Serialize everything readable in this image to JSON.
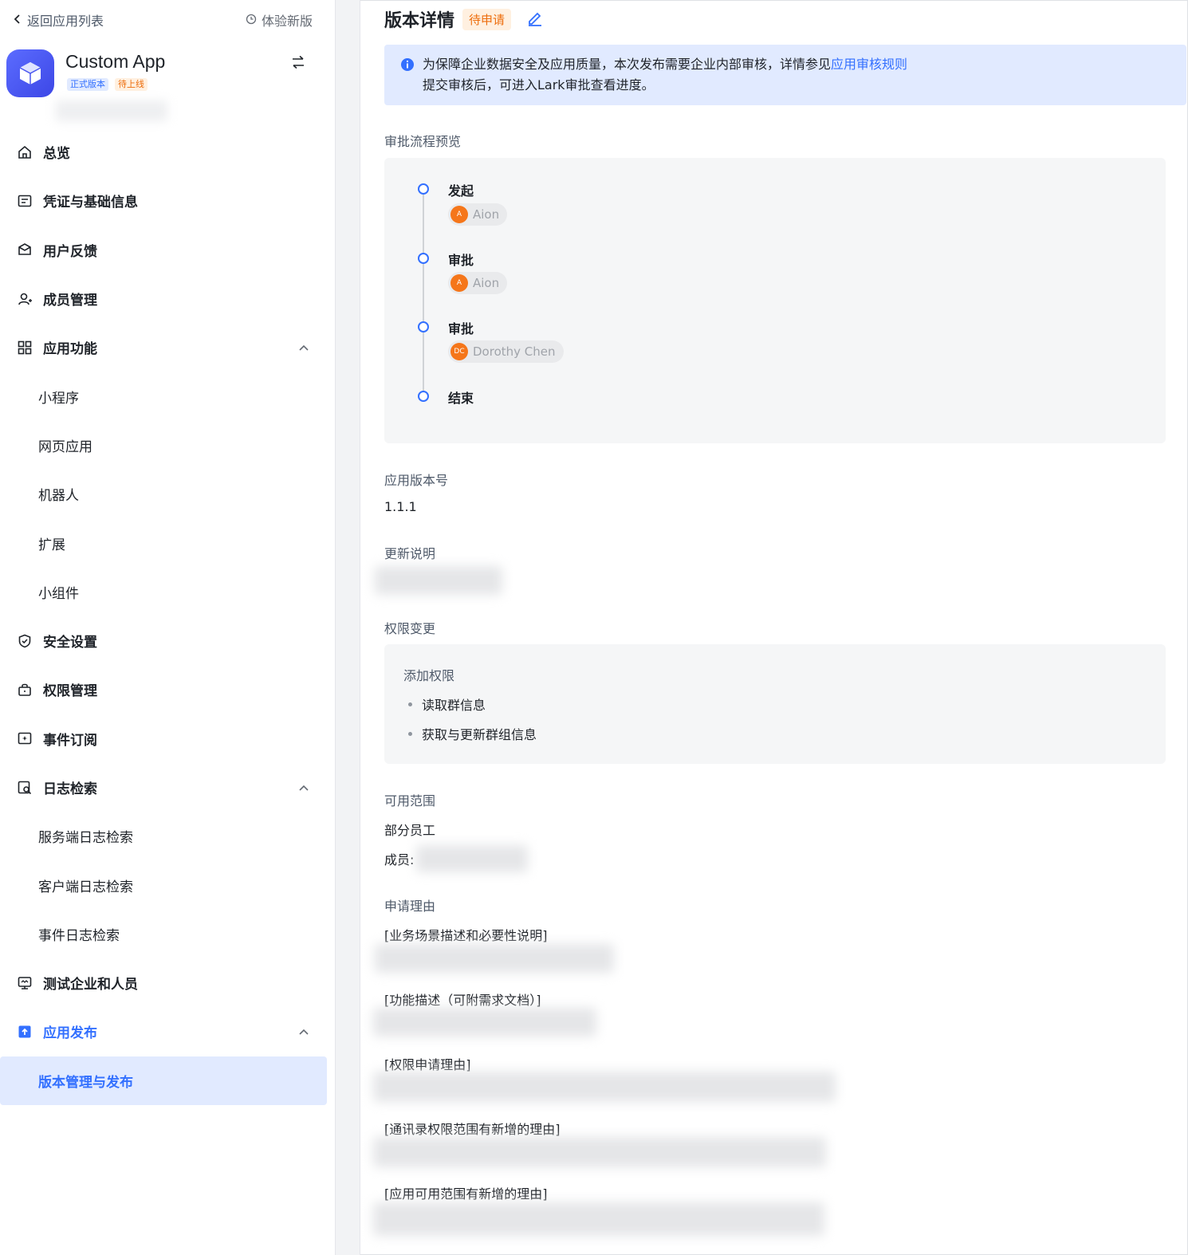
{
  "sidebar": {
    "back_label": "返回应用列表",
    "new_version_label": "体验新版",
    "app_name": "Custom App",
    "tag_release": "正式版本",
    "tag_pending": "待上线",
    "nav": {
      "overview": "总览",
      "credentials": "凭证与基础信息",
      "feedback": "用户反馈",
      "members": "成员管理",
      "features": "应用功能",
      "mini_program": "小程序",
      "web_app": "网页应用",
      "bot": "机器人",
      "extension": "扩展",
      "widget": "小组件",
      "security": "安全设置",
      "permissions": "权限管理",
      "events": "事件订阅",
      "logs": "日志检索",
      "server_logs": "服务端日志检索",
      "client_logs": "客户端日志检索",
      "event_logs": "事件日志检索",
      "test_tenant": "测试企业和人员",
      "publish": "应用发布",
      "version_mgmt": "版本管理与发布"
    }
  },
  "main": {
    "title": "版本详情",
    "status": "待申请",
    "notice_line1": "为保障企业数据安全及应用质量，本次发布需要企业内部审核，详情参见",
    "notice_link": "应用审核规则",
    "notice_line2": "提交审核后，可进入Lark审批查看进度。",
    "flow_label": "审批流程预览",
    "flow": {
      "step1": "发起",
      "step1_user": "Aion",
      "step1_initial": "A",
      "step2": "审批",
      "step2_user": "Aion",
      "step2_initial": "A",
      "step3": "审批",
      "step3_user": "Dorothy Chen",
      "step3_initial": "DC",
      "step4": "结束"
    },
    "version_label": "应用版本号",
    "version_value": "1.1.1",
    "notes_label": "更新说明",
    "perm_label": "权限变更",
    "perm_add_title": "添加权限",
    "perm_item1": "读取群信息",
    "perm_item2": "获取与更新群组信息",
    "scope_label": "可用范围",
    "scope_value": "部分员工",
    "scope_members_prefix": "成员:",
    "reason_label": "申请理由",
    "reason1": "[业务场景描述和必要性说明]",
    "reason2": "[功能描述（可附需求文档）]",
    "reason3": "[权限申请理由]",
    "reason4": "[通讯录权限范围有新增的理由]",
    "reason5": "[应用可用范围有新增的理由]"
  },
  "colors": {
    "accent": "#3370ff",
    "pending_orange": "#ed6d0c",
    "notice_bg": "#e1eaff"
  },
  "icons": [
    "chevron-left-icon",
    "history-icon",
    "app-cube-icon",
    "swap-icon",
    "home-icon",
    "credential-icon",
    "feedback-icon",
    "user-icon",
    "grid-icon",
    "chevron-up-icon",
    "shield-icon",
    "lock-icon",
    "event-icon",
    "log-search-icon",
    "test-icon",
    "publish-icon",
    "edit-icon",
    "info-icon"
  ]
}
